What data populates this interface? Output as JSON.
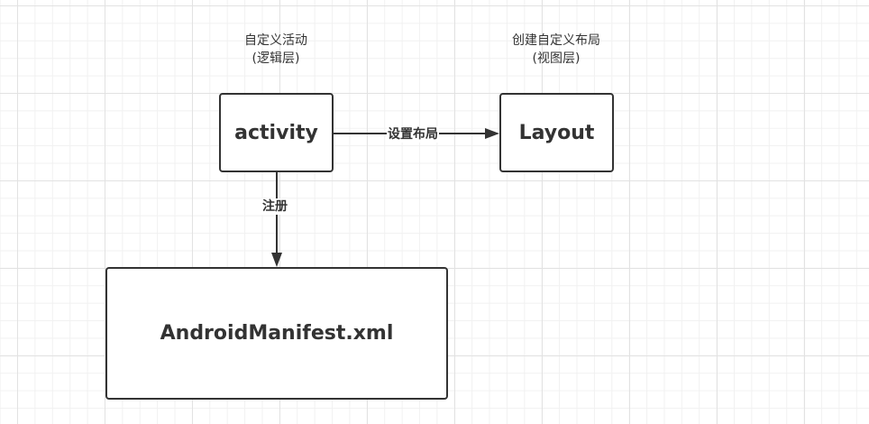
{
  "diagram": {
    "nodes": {
      "activity": {
        "label": "activity"
      },
      "layout": {
        "label": "Layout"
      },
      "manifest": {
        "label": "AndroidManifest.xml"
      }
    },
    "captions": {
      "activity": {
        "line1": "自定义活动",
        "line2": "(逻辑层)"
      },
      "layout": {
        "line1": "创建自定义布局",
        "line2": "(视图层)"
      }
    },
    "edges": {
      "set_layout": {
        "label": "设置布局"
      },
      "register": {
        "label": "注册"
      }
    },
    "colors": {
      "stroke": "#333333",
      "text": "#333333",
      "grid_major": "#e2e2e2",
      "grid_minor": "#f1f1f1",
      "background": "#ffffff"
    }
  }
}
